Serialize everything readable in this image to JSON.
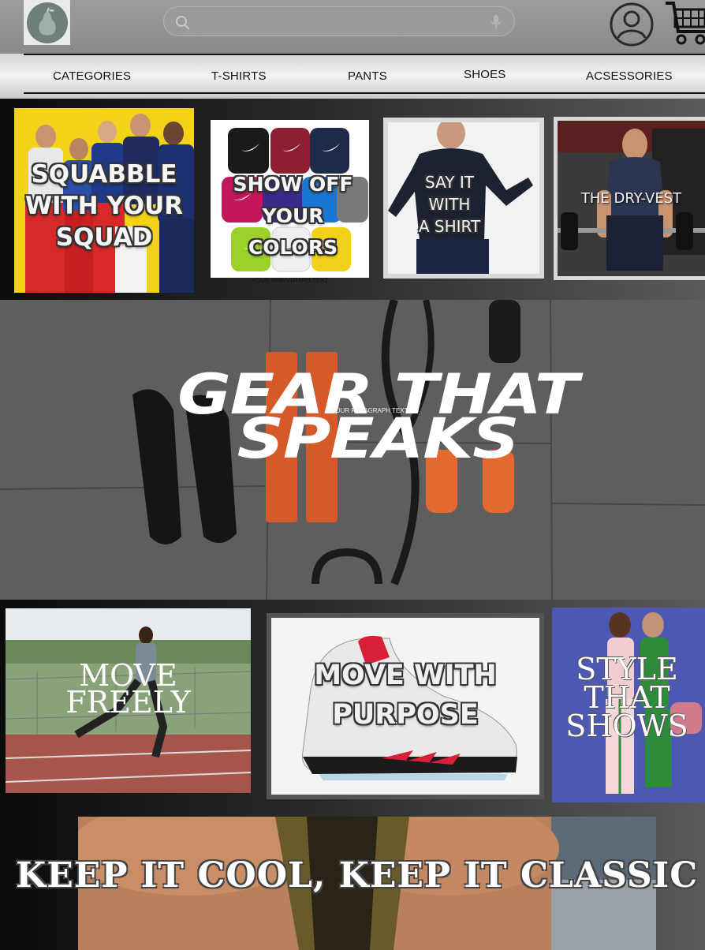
{
  "header": {
    "search": {
      "placeholder": "",
      "value": ""
    },
    "icons": {
      "search": "search-icon",
      "mic": "microphone-icon",
      "account": "account-icon",
      "cart": "shopping-cart-icon",
      "logo": "pear-logo"
    }
  },
  "nav": {
    "items": [
      {
        "label": "CATEGORIES"
      },
      {
        "label": "T-SHIRTS"
      },
      {
        "label": "PANTS"
      },
      {
        "label": "SHOES"
      },
      {
        "label": "ACSESSORIES"
      }
    ]
  },
  "promos": [
    {
      "line1": "SQUABBLE",
      "line2": "WITH YOUR",
      "line3": "SQUAD"
    },
    {
      "line1": "SHOW OFF",
      "line2": "YOUR COLORS",
      "caption": "YOUR PARAGRAPH TEXT"
    },
    {
      "line1": "SAY IT",
      "line2": "WITH",
      "line3": "A SHIRT"
    },
    {
      "line1": "THE DRY-VEST"
    }
  ],
  "hero": {
    "line1": "GEAR THAT",
    "line2": "SPEAKS",
    "caption": "YOUR PARAGRAPH TEXT"
  },
  "features": [
    {
      "line1": "MOVE",
      "line2": "FREELY"
    },
    {
      "line1": "MOVE WITH",
      "line2": "PURPOSE"
    },
    {
      "line1": "STYLE",
      "line2": "THAT",
      "line3": "SHOWS"
    }
  ],
  "banner": {
    "title": "KEEP IT COOL, KEEP IT CLASSIC"
  },
  "colors": {
    "header": "#8f8f8f",
    "nav": "#e6e6e6",
    "page": "#1e1e1e"
  }
}
